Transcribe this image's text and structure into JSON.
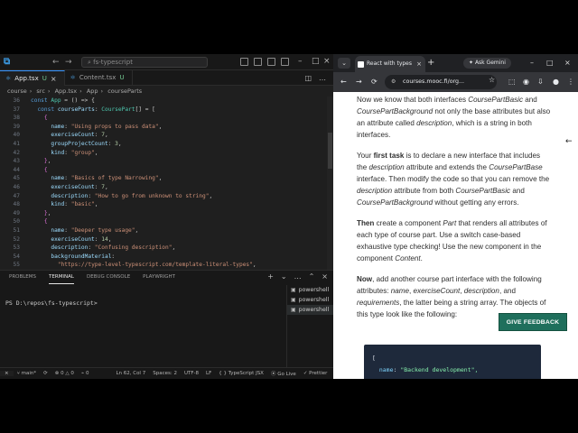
{
  "vscode": {
    "search_placeholder": "fs-typescript",
    "tabs": [
      {
        "label": "App.tsx",
        "status": "U",
        "active": true
      },
      {
        "label": "Content.tsx",
        "status": "U",
        "active": false
      }
    ],
    "breadcrumb": [
      "course",
      "src",
      "App.tsx",
      "App",
      "courseParts"
    ],
    "code_lines": [
      {
        "n": "36",
        "html": "<span class='k'>const</span> <span class='t'>App</span> <span class='p'>= () =&gt; {</span>",
        "indent": 0
      },
      {
        "n": "37",
        "html": "<span class='k'>const</span> <span class='v'>courseParts</span><span class='p'>: </span><span class='t'>CoursePart</span><span class='p'>[] = [</span>",
        "indent": 1
      },
      {
        "n": "38",
        "html": "<span class='br'>{</span>",
        "indent": 2
      },
      {
        "n": "39",
        "html": "<span class='v'>name</span><span class='p'>: </span><span class='s'>\"Using props to pass data\"</span><span class='p'>,</span>",
        "indent": 3
      },
      {
        "n": "40",
        "html": "<span class='v'>exerciseCount</span><span class='p'>: </span><span class='n'>7</span><span class='p'>,</span>",
        "indent": 3
      },
      {
        "n": "41",
        "html": "<span class='v'>groupProjectCount</span><span class='p'>: </span><span class='n'>3</span><span class='p'>,</span>",
        "indent": 3
      },
      {
        "n": "42",
        "html": "<span class='v'>kind</span><span class='p'>: </span><span class='s'>\"group\"</span><span class='p'>,</span>",
        "indent": 3
      },
      {
        "n": "43",
        "html": "<span class='br'>}</span><span class='p'>,</span>",
        "indent": 2
      },
      {
        "n": "44",
        "html": "<span class='br'>{</span>",
        "indent": 2
      },
      {
        "n": "45",
        "html": "<span class='v'>name</span><span class='p'>: </span><span class='s'>\"Basics of type Narrowing\"</span><span class='p'>,</span>",
        "indent": 3
      },
      {
        "n": "46",
        "html": "<span class='v'>exerciseCount</span><span class='p'>: </span><span class='n'>7</span><span class='p'>,</span>",
        "indent": 3
      },
      {
        "n": "47",
        "html": "<span class='v'>description</span><span class='p'>: </span><span class='s'>\"How to go from unknown to string\"</span><span class='p'>,</span>",
        "indent": 3
      },
      {
        "n": "48",
        "html": "<span class='v'>kind</span><span class='p'>: </span><span class='s'>\"basic\"</span><span class='p'>,</span>",
        "indent": 3
      },
      {
        "n": "49",
        "html": "<span class='br'>}</span><span class='p'>,</span>",
        "indent": 2
      },
      {
        "n": "50",
        "html": "<span class='br'>{</span>",
        "indent": 2
      },
      {
        "n": "51",
        "html": "<span class='v'>name</span><span class='p'>: </span><span class='s'>\"Deeper type usage\"</span><span class='p'>,</span>",
        "indent": 3
      },
      {
        "n": "52",
        "html": "<span class='v'>exerciseCount</span><span class='p'>: </span><span class='n'>14</span><span class='p'>,</span>",
        "indent": 3
      },
      {
        "n": "53",
        "html": "<span class='v'>description</span><span class='p'>: </span><span class='s'>\"Confusing description\"</span><span class='p'>,</span>",
        "indent": 3
      },
      {
        "n": "54",
        "html": "<span class='v'>backgroundMaterial</span><span class='p'>:</span>",
        "indent": 3
      },
      {
        "n": "55",
        "html": "<span class='s'>\"https://type-level-typescript.com/template-literal-types\"</span><span class='p'>,</span>",
        "indent": 4
      }
    ],
    "panel_tabs": [
      "PROBLEMS",
      "TERMINAL",
      "DEBUG CONSOLE",
      "PLAYWRIGHT"
    ],
    "active_panel_tab": "TERMINAL",
    "terminal_prompt": "PS D:\\repos\\fs-typescript>",
    "terminals": [
      "powershell",
      "powershell",
      "powershell"
    ],
    "status": {
      "branch": "main*",
      "errors": "0",
      "warnings": "0",
      "ports": "0",
      "position": "Ln 62, Col 7",
      "spaces": "Spaces: 2",
      "encoding": "UTF-8",
      "eol": "LF",
      "language": "TypeScript JSX",
      "golive": "Go Live",
      "prettier": "Prettier"
    }
  },
  "browser": {
    "tab_title": "React with types",
    "gemini": "Ask Gemini",
    "url": "courses.mooc.fi/org...",
    "article": {
      "p1": "Now we know that both interfaces <em>CoursePartBasic</em> and <em>CoursePartBackground</em> not only the base attributes but also an attribute called <em>description</em>, which is a string in both interfaces.",
      "p2": "Your <b>first task</b> is to declare a new interface that includes the <em>description</em> attribute and extends the <em>CoursePartBase</em> interface. Then modify the code so that you can remove the <em>description</em> attribute from both <em>CoursePartBasic</em> and <em>CoursePartBackground</em> without getting any errors.",
      "p3": "<b>Then</b> create a component <em>Part</em> that renders all attributes of each type of course part. Use a switch case-based exhaustive type checking! Use the new component in the component <em>Content</em>.",
      "p4": "<b>Now</b>, add another course part interface with the following attributes: <em>name</em>, <em>exerciseCount</em>, <em>description</em>, and <em>requirements</em>, the latter being a string array. The objects of this type look like the following:"
    },
    "code_card": {
      "line1": "[",
      "line2_key": "name",
      "line2_val": "\"Backend development\","
    },
    "feedback_button": "GIVE FEEDBACK"
  }
}
